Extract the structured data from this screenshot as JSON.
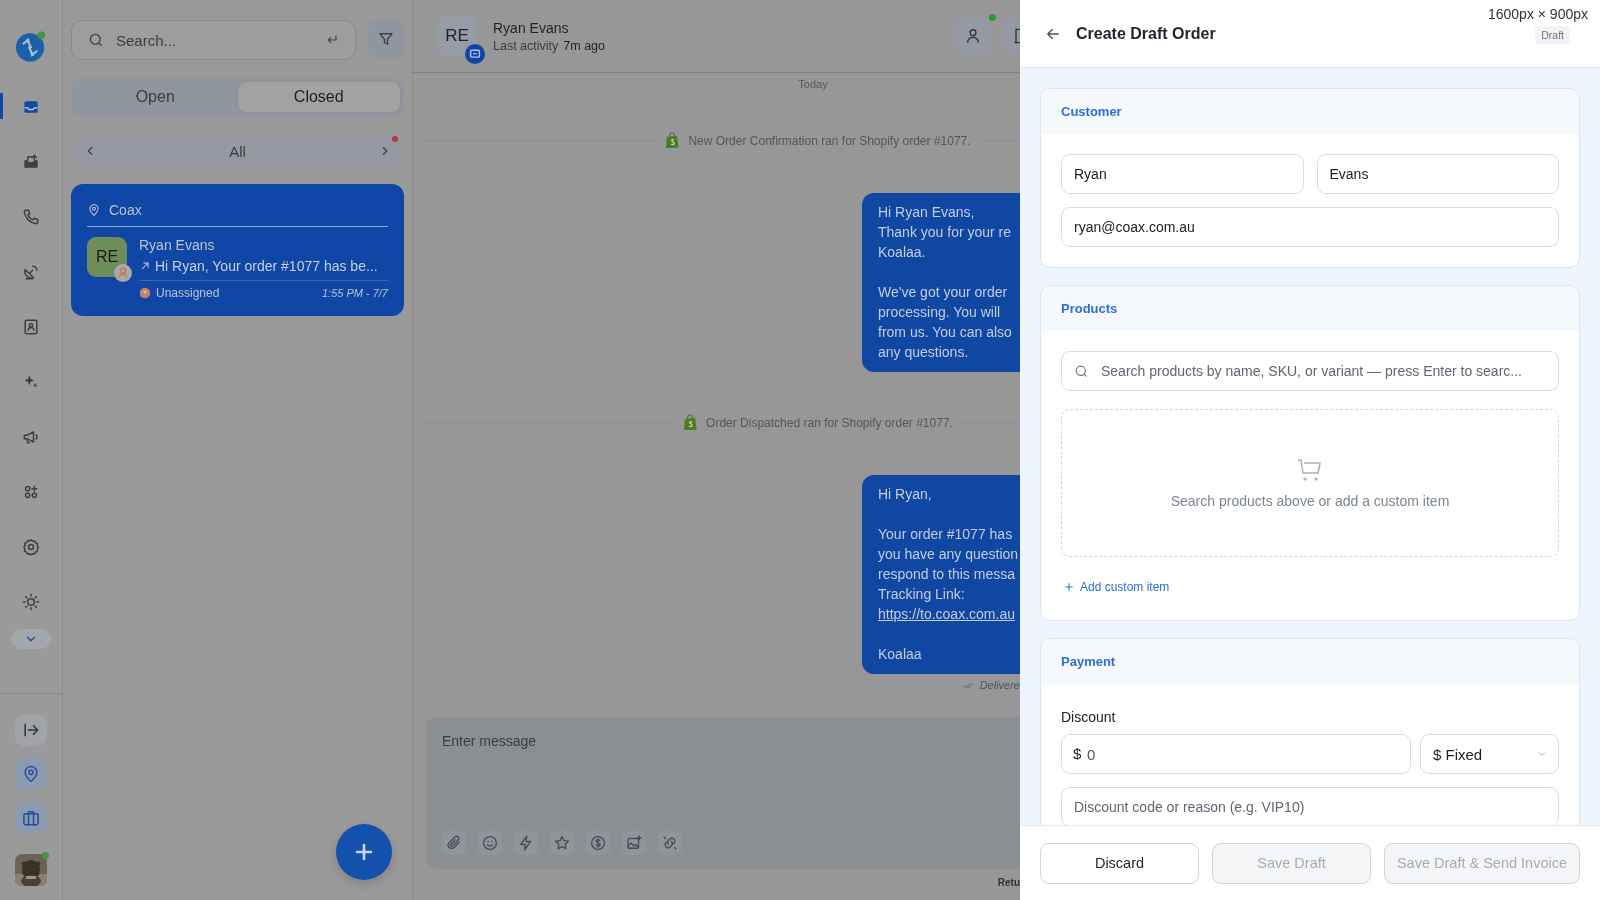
{
  "rail": {
    "items": [
      {
        "selected": true
      },
      {
        "selected": false
      },
      {
        "selected": false
      },
      {
        "selected": false
      },
      {
        "selected": false
      },
      {
        "selected": false
      },
      {
        "selected": false
      },
      {
        "selected": false
      },
      {
        "selected": false
      },
      {
        "selected": false
      }
    ],
    "bottom": [
      {
        "active": false
      },
      {
        "active": true
      },
      {
        "active": true
      }
    ],
    "user_online": true
  },
  "inbox": {
    "search": {
      "placeholder": "Search..."
    },
    "tabs": [
      {
        "label": "Open",
        "selected": false
      },
      {
        "label": "Closed",
        "selected": true
      }
    ],
    "filter": {
      "label": "All",
      "alert": true
    },
    "conversations": [
      {
        "location": "Coax",
        "initials": "RE",
        "name": "Ryan Evans",
        "preview": "Hi Ryan, Your order #1077 has be...",
        "assignee": "Unassigned",
        "time": "1:55 PM - 7/7",
        "selected": true
      }
    ]
  },
  "chat": {
    "contact": {
      "initials": "RE",
      "name": "Ryan Evans",
      "activity_label": "Last activity",
      "activity_time": "7m ago",
      "online": true
    },
    "day": "Today",
    "timeline": [
      {
        "kind": "event",
        "text": "New Order Confirmation ran for Shopify order #1077."
      },
      {
        "kind": "message",
        "lines": [
          {
            "kind": "text",
            "text": "Hi Ryan Evans,"
          },
          {
            "kind": "text",
            "text": "Thank you for your re"
          },
          {
            "kind": "text",
            "text": "Koalaa."
          },
          {
            "kind": "gap"
          },
          {
            "kind": "text",
            "text": "We've got your order"
          },
          {
            "kind": "text",
            "text": "processing. You will"
          },
          {
            "kind": "text",
            "text": "from us. You can also"
          },
          {
            "kind": "text",
            "text": "any questions."
          }
        ]
      },
      {
        "kind": "event",
        "text": "Order Dispatched ran for Shopify order #1077."
      },
      {
        "kind": "message",
        "lines": [
          {
            "kind": "text",
            "text": "Hi Ryan,"
          },
          {
            "kind": "gap"
          },
          {
            "kind": "text",
            "text": "Your order #1077 has"
          },
          {
            "kind": "text",
            "text": "you have any question"
          },
          {
            "kind": "text",
            "text": "respond to this messa"
          },
          {
            "kind": "text",
            "text": "Tracking Link:"
          },
          {
            "kind": "link",
            "text": "https://to.coax.com.au"
          },
          {
            "kind": "gap"
          },
          {
            "kind": "text",
            "text": "Koalaa"
          }
        ],
        "status": "Delivere"
      }
    ],
    "composer": {
      "placeholder": "Enter message"
    },
    "footer_hint": "Retu"
  },
  "drawer": {
    "size_note": "1600px × 900px",
    "title": "Create Draft Order",
    "badge": "Draft",
    "customer": {
      "heading": "Customer",
      "first_name": "Ryan",
      "last_name": "Evans",
      "email": "ryan@coax.com.au"
    },
    "products": {
      "heading": "Products",
      "search_placeholder": "Search products by name, SKU, or variant — press Enter to searc...",
      "empty_text": "Search products above or add a custom item",
      "add_link": "Add custom item"
    },
    "payment": {
      "heading": "Payment",
      "discount_label": "Discount",
      "currency": "$",
      "amount_placeholder": "0",
      "type": "$ Fixed",
      "code_placeholder": "Discount code or reason (e.g. VIP10)"
    },
    "buttons": [
      {
        "label": "Discard",
        "disabled": false
      },
      {
        "label": "Save Draft",
        "disabled": true
      },
      {
        "label": "Save Draft & Send Invoice",
        "disabled": true
      }
    ]
  }
}
